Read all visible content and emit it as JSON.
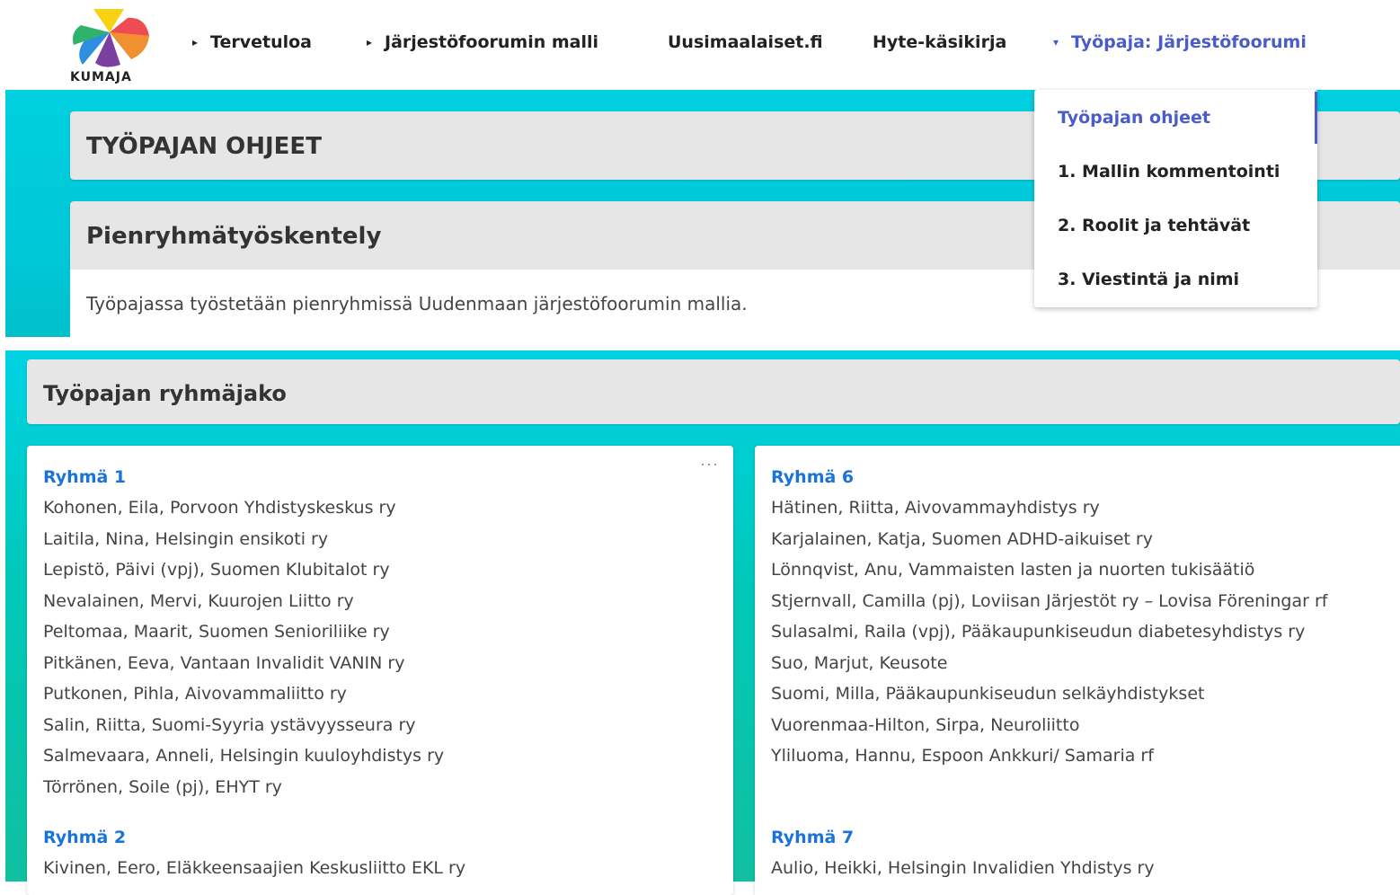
{
  "brand": {
    "name": "KUMAJA",
    "colors": {
      "yellow": "#f5d312",
      "red": "#ee4b52",
      "green": "#2fb36a",
      "blue": "#2f8ee0",
      "orange": "#f09030"
    }
  },
  "nav": {
    "items": [
      {
        "label": "Tervetuloa",
        "caret": "▸"
      },
      {
        "label": "Järjestöfoorumin malli",
        "caret": "▸"
      },
      {
        "label": "Uusimaalaiset.fi"
      },
      {
        "label": "Hyte-käsikirja"
      },
      {
        "label": "Työpaja: Järjestöfoorumi",
        "caret": "▾"
      }
    ]
  },
  "dropdown": {
    "items": [
      "Työpajan ohjeet",
      "1. Mallin kommentointi",
      "2. Roolit ja tehtävät",
      "3. Viestintä ja nimi"
    ]
  },
  "section1": {
    "title": "TYÖPAJAN OHJEET",
    "subtitle": "Pienryhmätyöskentely",
    "text": "Työpajassa työstetään pienryhmissä Uudenmaan järjestöfoorumin mallia."
  },
  "section2": {
    "title": "Työpajan ryhmäjako"
  },
  "left_card": {
    "more": "···",
    "group1": {
      "title": "Ryhmä 1",
      "members": [
        "Kohonen, Eila, Porvoon Yhdistyskeskus ry",
        "Laitila, Nina, Helsingin ensikoti ry",
        "Lepistö, Päivi (vpj), Suomen Klubitalot ry",
        "Nevalainen, Mervi, Kuurojen Liitto ry",
        "Peltomaa, Maarit, Suomen Senioriliike ry",
        "Pitkänen, Eeva, Vantaan Invalidit VANIN ry",
        "Putkonen, Pihla, Aivovammaliitto ry",
        "Salin, Riitta, Suomi-Syyria ystävyysseura ry",
        "Salmevaara, Anneli, Helsingin kuuloyhdistys ry",
        "Törrönen, Soile (pj), EHYT ry"
      ]
    },
    "group2": {
      "title": "Ryhmä 2",
      "members": [
        "Kivinen, Eero, Eläkkeensaajien Keskusliitto EKL ry"
      ]
    }
  },
  "right_card": {
    "group6": {
      "title": "Ryhmä 6",
      "members": [
        "Hätinen, Riitta, Aivovammayhdistys ry",
        "Karjalainen, Katja, Suomen ADHD-aikuiset ry",
        "Lönnqvist, Anu, Vammaisten lasten ja nuorten tukisäätiö",
        "Stjernvall, Camilla (pj), Loviisan Järjestöt ry – Lovisa Föreningar rf",
        "Sulasalmi, Raila (vpj), Pääkaupunkiseudun diabetesyhdistys ry",
        "Suo, Marjut, Keusote",
        "Suomi, Milla, Pääkaupunkiseudun selkäyhdistykset",
        "Vuorenmaa-Hilton, Sirpa, Neuroliitto",
        "Yliluoma, Hannu, Espoon Ankkuri/ Samaria rf"
      ]
    },
    "group7": {
      "title": "Ryhmä 7",
      "members": [
        "Aulio, Heikki, Helsingin Invalidien Yhdistys ry"
      ]
    }
  }
}
